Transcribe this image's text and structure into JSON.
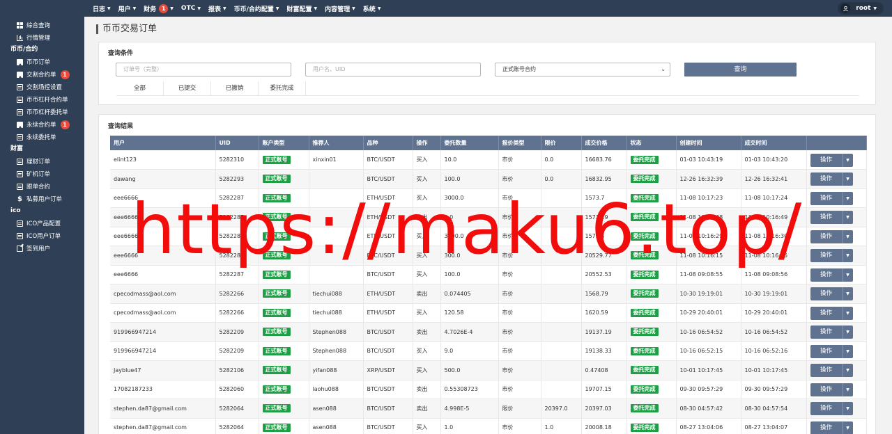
{
  "topnav": {
    "items": [
      {
        "label": "日志"
      },
      {
        "label": "用户"
      },
      {
        "label": "财务",
        "badge": "1"
      },
      {
        "label": "OTC"
      },
      {
        "label": "报表"
      },
      {
        "label": "币币/合约配置"
      },
      {
        "label": "财富配置"
      },
      {
        "label": "内容管理"
      },
      {
        "label": "系统"
      }
    ],
    "user": "root"
  },
  "sidebar": {
    "items": [
      {
        "type": "item",
        "label": "综合查询",
        "icon": "dashboard-icon"
      },
      {
        "type": "item",
        "label": "行情管理",
        "icon": "market-icon"
      },
      {
        "type": "group",
        "label": "币币/合约"
      },
      {
        "type": "item",
        "label": "币币订单",
        "icon": "bookmark-icon"
      },
      {
        "type": "item",
        "label": "交割合约单",
        "icon": "bookmark-icon",
        "badge": "1"
      },
      {
        "type": "item",
        "label": "交割场控设置",
        "icon": "document-icon"
      },
      {
        "type": "item",
        "label": "币币杠杆合约单",
        "icon": "document-icon"
      },
      {
        "type": "item",
        "label": "币币杠杆委托单",
        "icon": "document-icon"
      },
      {
        "type": "item",
        "label": "永续合约单",
        "icon": "bookmark-icon",
        "badge": "1"
      },
      {
        "type": "item",
        "label": "永续委托单",
        "icon": "document-icon"
      },
      {
        "type": "group",
        "label": "财富"
      },
      {
        "type": "item",
        "label": "理财订单",
        "icon": "document-icon"
      },
      {
        "type": "item",
        "label": "矿机订单",
        "icon": "document-icon"
      },
      {
        "type": "item",
        "label": "跟单合约",
        "icon": "document-icon"
      },
      {
        "type": "item",
        "label": "私募用户订单",
        "icon": "dollar-icon"
      },
      {
        "type": "group",
        "label": "ico"
      },
      {
        "type": "item",
        "label": "ICO产品配置",
        "icon": "document-icon"
      },
      {
        "type": "item",
        "label": "ICO用户订单",
        "icon": "document-icon"
      },
      {
        "type": "item",
        "label": "签到用户",
        "icon": "edit-icon"
      }
    ]
  },
  "page": {
    "title": "币币交易订单"
  },
  "filter": {
    "title": "查询条件",
    "order_placeholder": "订单号（完整）",
    "user_placeholder": "用户名、UID",
    "account_select": "正式账号合约",
    "search_label": "查询",
    "tabs": [
      "全部",
      "已提交",
      "已撤销",
      "委托完成"
    ]
  },
  "results": {
    "title": "查询结果",
    "columns": [
      "用户",
      "UID",
      "账户类型",
      "推荐人",
      "品种",
      "操作",
      "委托数量",
      "报价类型",
      "限价",
      "成交价格",
      "状态",
      "创建时间",
      "成交时间",
      ""
    ],
    "action_label": "操作",
    "rows": [
      [
        "elint123",
        "5282310",
        "正式账号",
        "xinxin01",
        "BTC/USDT",
        "买入",
        "10.0",
        "市价",
        "0.0",
        "16683.76",
        "委托完成",
        "01-03 10:43:19",
        "01-03 10:43:20"
      ],
      [
        "dawang",
        "5282293",
        "正式账号",
        "",
        "BTC/USDT",
        "买入",
        "100.0",
        "市价",
        "0.0",
        "16832.95",
        "委托完成",
        "12-26 16:32:39",
        "12-26 16:32:41"
      ],
      [
        "eee6666",
        "5282287",
        "正式账号",
        "",
        "ETH/USDT",
        "买入",
        "3000.0",
        "市价",
        "",
        "1573.7",
        "委托完成",
        "11-08 10:17:23",
        "11-08 10:17:24"
      ],
      [
        "eee6666",
        "5282287",
        "正式账号",
        "",
        "ETH/USDT",
        "卖出",
        "1.0",
        "市价",
        "",
        "1573.19",
        "委托完成",
        "11-08 10:16:48",
        "11-08 10:16:49"
      ],
      [
        "eee6666",
        "5282287",
        "正式账号",
        "",
        "ETH/USDT",
        "买入",
        "3300.0",
        "市价",
        "",
        "1572.4",
        "委托完成",
        "11-08 10:16:29",
        "11-08 10:16:30"
      ],
      [
        "eee6666",
        "5282287",
        "正式账号",
        "",
        "BTC/USDT",
        "买入",
        "300.0",
        "市价",
        "",
        "20529.77",
        "委托完成",
        "11-08 10:16:15",
        "11-08 10:16:15"
      ],
      [
        "eee6666",
        "5282287",
        "正式账号",
        "",
        "BTC/USDT",
        "买入",
        "100.0",
        "市价",
        "",
        "20552.53",
        "委托完成",
        "11-08 09:08:55",
        "11-08 09:08:56"
      ],
      [
        "cpecodmass@aol.com",
        "5282266",
        "正式账号",
        "tiechui088",
        "ETH/USDT",
        "卖出",
        "0.074405",
        "市价",
        "",
        "1568.79",
        "委托完成",
        "10-30 19:19:01",
        "10-30 19:19:01"
      ],
      [
        "cpecodmass@aol.com",
        "5282266",
        "正式账号",
        "tiechui088",
        "ETH/USDT",
        "买入",
        "120.58",
        "市价",
        "",
        "1620.59",
        "委托完成",
        "10-29 20:40:01",
        "10-29 20:40:01"
      ],
      [
        "919966947214",
        "5282209",
        "正式账号",
        "Stephen088",
        "BTC/USDT",
        "卖出",
        "4.7026E-4",
        "市价",
        "",
        "19137.19",
        "委托完成",
        "10-16 06:54:52",
        "10-16 06:54:52"
      ],
      [
        "919966947214",
        "5282209",
        "正式账号",
        "Stephen088",
        "BTC/USDT",
        "买入",
        "9.0",
        "市价",
        "",
        "19138.33",
        "委托完成",
        "10-16 06:52:15",
        "10-16 06:52:16"
      ],
      [
        "Jayblue47",
        "5282106",
        "正式账号",
        "yifan088",
        "XRP/USDT",
        "买入",
        "500.0",
        "市价",
        "",
        "0.47408",
        "委托完成",
        "10-01 10:17:45",
        "10-01 10:17:45"
      ],
      [
        "17082187233",
        "5282060",
        "正式账号",
        "laohu088",
        "BTC/USDT",
        "卖出",
        "0.55308723",
        "市价",
        "",
        "19707.15",
        "委托完成",
        "09-30 09:57:29",
        "09-30 09:57:29"
      ],
      [
        "stephen.da87@gmail.com",
        "5282064",
        "正式账号",
        "asen088",
        "BTC/USDT",
        "卖出",
        "4.998E-5",
        "限价",
        "20397.0",
        "20397.03",
        "委托完成",
        "08-30 04:57:42",
        "08-30 04:57:54"
      ],
      [
        "stephen.da87@gmail.com",
        "5282064",
        "正式账号",
        "asen088",
        "BTC/USDT",
        "买入",
        "1.0",
        "市价",
        "1.0",
        "20008.18",
        "委托完成",
        "08-27 13:04:06",
        "08-27 13:04:07"
      ]
    ]
  },
  "watermark": "https://maku6.top/",
  "colors": {
    "sidebar_bg": "#2f4056",
    "header_bg": "#5f7391",
    "tag_green": "#1e9e45",
    "badge_red": "#e74c3c",
    "watermark_red": "#f20c0c"
  }
}
